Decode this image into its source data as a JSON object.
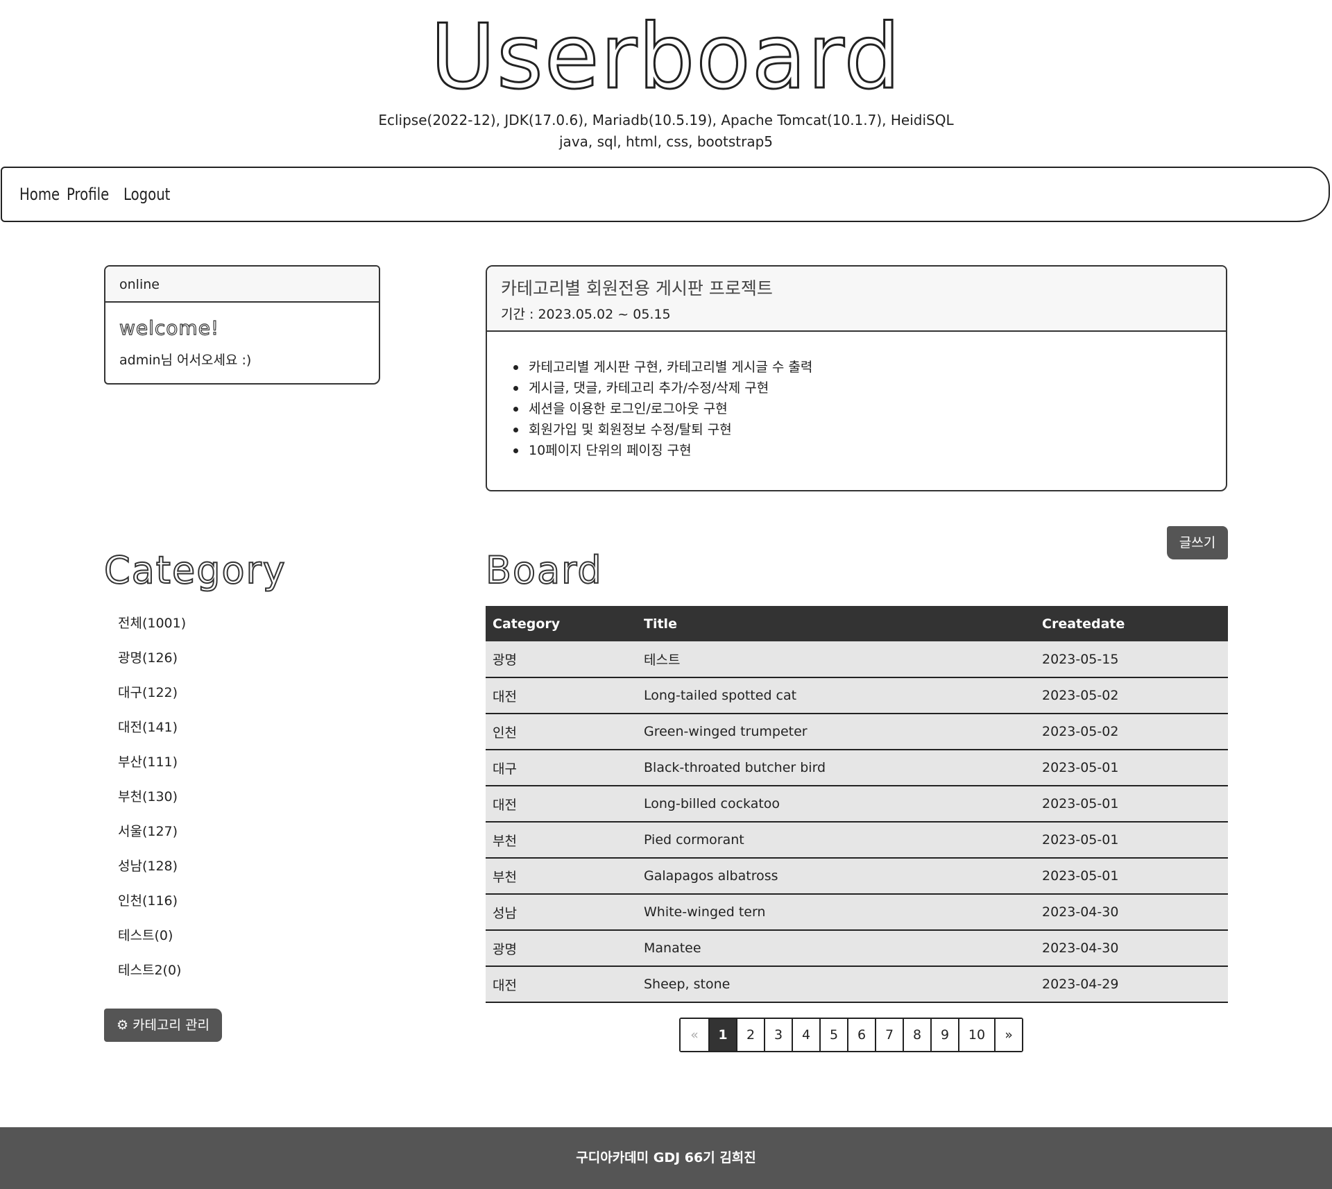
{
  "header": {
    "title": "Userboard",
    "stack_line1": "Eclipse(2022-12), JDK(17.0.6), Mariadb(10.5.19), Apache Tomcat(10.1.7), HeidiSQL",
    "stack_line2": "java, sql, html, css, bootstrap5"
  },
  "nav": {
    "home": "Home",
    "profile": "Profile",
    "logout": "Logout"
  },
  "online_card": {
    "header": "online",
    "welcome": "welcome!",
    "message": "admin님 어서오세요 :)"
  },
  "project_card": {
    "title": "카테고리별 회원전용 게시판 프로젝트",
    "period": "기간 : 2023.05.02 ~ 05.15",
    "features": [
      "카테고리별 게시판 구현, 카테고리별 게시글 수 출력",
      "게시글, 댓글, 카테고리 추가/수정/삭제 구현",
      "세션을 이용한 로그인/로그아웃 구현",
      "회원가입 및 회원정보 수정/탈퇴 구현",
      "10페이지 단위의 페이징 구현"
    ]
  },
  "category": {
    "heading": "Category",
    "items": [
      "전체(1001)",
      "광명(126)",
      "대구(122)",
      "대전(141)",
      "부산(111)",
      "부천(130)",
      "서울(127)",
      "성남(128)",
      "인천(116)",
      "테스트(0)",
      "테스트2(0)"
    ],
    "manage_label": "⚙ 카테고리 관리"
  },
  "board": {
    "heading": "Board",
    "write_label": "글쓰기",
    "columns": [
      "Category",
      "Title",
      "Createdate"
    ],
    "rows": [
      [
        "광명",
        "테스트",
        "2023-05-15"
      ],
      [
        "대전",
        "Long-tailed spotted cat",
        "2023-05-02"
      ],
      [
        "인천",
        "Green-winged trumpeter",
        "2023-05-02"
      ],
      [
        "대구",
        "Black-throated butcher bird",
        "2023-05-01"
      ],
      [
        "대전",
        "Long-billed cockatoo",
        "2023-05-01"
      ],
      [
        "부천",
        "Pied cormorant",
        "2023-05-01"
      ],
      [
        "부천",
        "Galapagos albatross",
        "2023-05-01"
      ],
      [
        "성남",
        "White-winged tern",
        "2023-04-30"
      ],
      [
        "광명",
        "Manatee",
        "2023-04-30"
      ],
      [
        "대전",
        "Sheep, stone",
        "2023-04-29"
      ]
    ]
  },
  "pagination": {
    "prev": "«",
    "pages": [
      "1",
      "2",
      "3",
      "4",
      "5",
      "6",
      "7",
      "8",
      "9",
      "10"
    ],
    "next": "»",
    "current": "1"
  },
  "footer": {
    "text": "구디아카데미 GDJ 66기 김희진"
  },
  "colors": {
    "dark": "#333333",
    "button": "#555555",
    "row": "#e6e6e6"
  }
}
